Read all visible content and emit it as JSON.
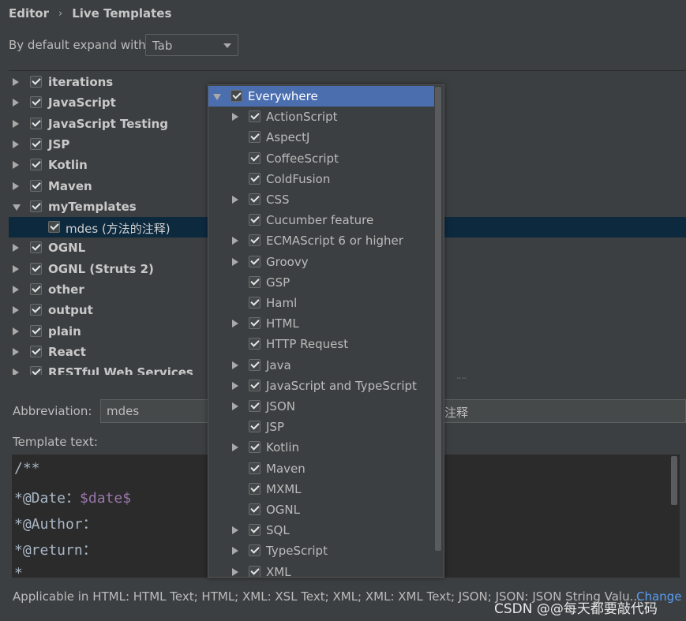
{
  "breadcrumb": {
    "parent": "Editor",
    "separator": "›",
    "current": "Live Templates"
  },
  "expand": {
    "label": "By default expand with",
    "value": "Tab"
  },
  "template_groups": [
    {
      "label": "iterations",
      "checked": true,
      "state": "collapsed"
    },
    {
      "label": "JavaScript",
      "checked": true,
      "state": "collapsed"
    },
    {
      "label": "JavaScript Testing",
      "checked": true,
      "state": "collapsed"
    },
    {
      "label": "JSP",
      "checked": true,
      "state": "collapsed"
    },
    {
      "label": "Kotlin",
      "checked": true,
      "state": "collapsed"
    },
    {
      "label": "Maven",
      "checked": true,
      "state": "collapsed"
    },
    {
      "label": "myTemplates",
      "checked": true,
      "state": "expanded"
    },
    {
      "label": "mdes (方法的注释)",
      "checked": true,
      "state": "child"
    },
    {
      "label": "OGNL",
      "checked": true,
      "state": "collapsed"
    },
    {
      "label": "OGNL (Struts 2)",
      "checked": true,
      "state": "collapsed"
    },
    {
      "label": "other",
      "checked": true,
      "state": "collapsed"
    },
    {
      "label": "output",
      "checked": true,
      "state": "collapsed"
    },
    {
      "label": "plain",
      "checked": true,
      "state": "collapsed"
    },
    {
      "label": "React",
      "checked": true,
      "state": "collapsed"
    },
    {
      "label": "RESTful Web Services",
      "checked": true,
      "state": "collapsed"
    }
  ],
  "abbreviation": {
    "label": "Abbreviation:",
    "value": "mdes",
    "description_tail": "注释"
  },
  "template_text": {
    "label": "Template text:",
    "lines": [
      {
        "text": "/**"
      },
      {
        "text": "*@Date：",
        "var": "$date$"
      },
      {
        "text": "*@Author："
      },
      {
        "text": "*@return："
      },
      {
        "text": "*"
      }
    ]
  },
  "applicable": {
    "text": "Applicable in HTML: HTML Text; HTML; XML: XSL Text; XML; XML: XML Text; JSON; JSON: JSON String Valu...",
    "change_label": "Change"
  },
  "context_popup": {
    "items": [
      {
        "label": "Everywhere",
        "checked": true,
        "toggle": "expanded",
        "highlighted": true
      },
      {
        "label": "ActionScript",
        "checked": true,
        "toggle": "collapsed"
      },
      {
        "label": "AspectJ",
        "checked": true,
        "toggle": "none"
      },
      {
        "label": "CoffeeScript",
        "checked": true,
        "toggle": "none"
      },
      {
        "label": "ColdFusion",
        "checked": true,
        "toggle": "none"
      },
      {
        "label": "CSS",
        "checked": true,
        "toggle": "collapsed"
      },
      {
        "label": "Cucumber feature",
        "checked": true,
        "toggle": "none"
      },
      {
        "label": "ECMAScript 6 or higher",
        "checked": true,
        "toggle": "collapsed"
      },
      {
        "label": "Groovy",
        "checked": true,
        "toggle": "collapsed"
      },
      {
        "label": "GSP",
        "checked": true,
        "toggle": "none"
      },
      {
        "label": "Haml",
        "checked": true,
        "toggle": "none"
      },
      {
        "label": "HTML",
        "checked": true,
        "toggle": "collapsed"
      },
      {
        "label": "HTTP Request",
        "checked": true,
        "toggle": "none"
      },
      {
        "label": "Java",
        "checked": true,
        "toggle": "collapsed"
      },
      {
        "label": "JavaScript and TypeScript",
        "checked": true,
        "toggle": "collapsed"
      },
      {
        "label": "JSON",
        "checked": true,
        "toggle": "collapsed"
      },
      {
        "label": "JSP",
        "checked": true,
        "toggle": "none"
      },
      {
        "label": "Kotlin",
        "checked": true,
        "toggle": "collapsed"
      },
      {
        "label": "Maven",
        "checked": true,
        "toggle": "none"
      },
      {
        "label": "MXML",
        "checked": true,
        "toggle": "none"
      },
      {
        "label": "OGNL",
        "checked": true,
        "toggle": "none"
      },
      {
        "label": "SQL",
        "checked": true,
        "toggle": "collapsed"
      },
      {
        "label": "TypeScript",
        "checked": true,
        "toggle": "collapsed"
      },
      {
        "label": "XML",
        "checked": true,
        "toggle": "collapsed"
      }
    ]
  },
  "watermark": "CSDN @@每天都要敲代码",
  "colors": {
    "background": "#3c3f41",
    "editor_background": "#2b2b2b",
    "selection": "#0d293e",
    "popup_highlight": "#4b6eaf",
    "link": "#589df6",
    "template_variable": "#9876aa"
  }
}
